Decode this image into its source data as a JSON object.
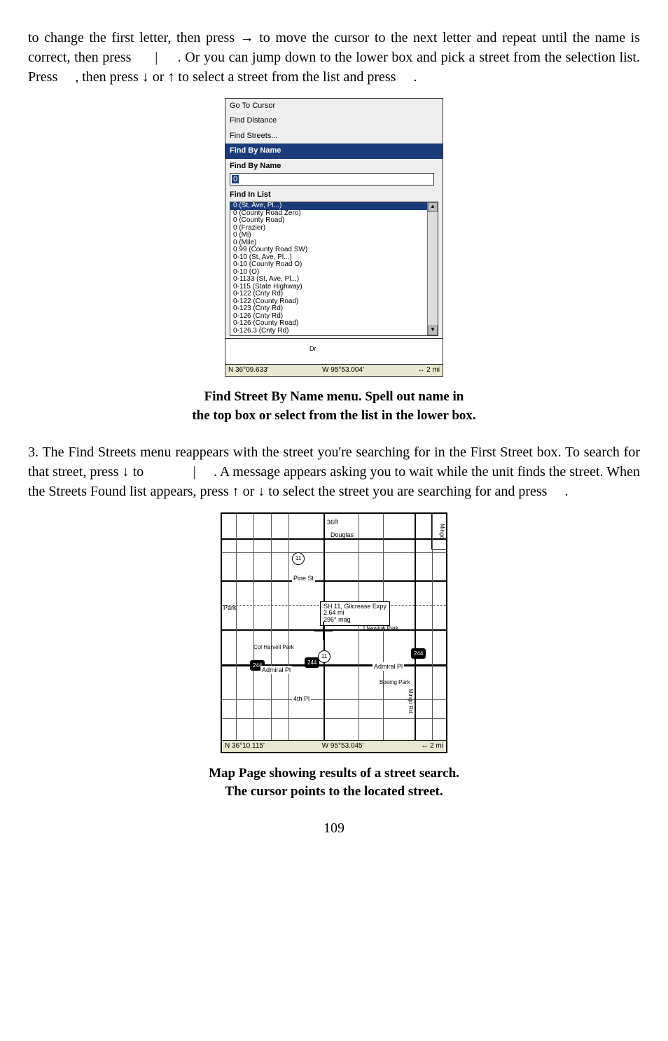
{
  "para1": "to change the first letter, then press → to move the cursor to the next letter and repeat until the name is correct, then press      |     . Or you can jump down to the lower box and pick a street from the selection list. Press     , then press ↓ or ↑ to select a street from the list and press     .",
  "caption1_line1": "Find Street By Name menu. Spell out name in",
  "caption1_line2": "the top box or select from the list in the lower box.",
  "para2": "3. The Find Streets menu reappears with the street you're searching for in the First Street box. To search for that street, press ↓ to              |     . A message appears asking you to wait while the unit finds the street. When the Streets Found list appears, press ↑ or ↓ to select the street you are searching for and press     .",
  "caption2_line1": "Map Page showing results of a street search.",
  "caption2_line2": "The cursor points to the located street.",
  "page_number": "109",
  "dialog": {
    "menu": {
      "item1": "Go To Cursor",
      "item2": "Find Distance",
      "item3": "Find Streets..."
    },
    "title": "Find By Name",
    "find_by_name_label": "Find By Name",
    "input_value": "0",
    "find_in_list_label": "Find In List",
    "list": [
      "0 (St, Ave, Pl...)",
      "0 (County Road Zero)",
      "0 (County Road)",
      "0 (Frazier)",
      "0 (Mi)",
      "0 (Mile)",
      "0 99 (County Road SW)",
      "0-10 (St, Ave, Pl...)",
      "0-10 (County Road O)",
      "0-10 (O)",
      "0-1133 (St, Ave, Pl...)",
      "0-115 (State Highway)",
      "0-122 (Cnty Rd)",
      "0-122 (County Road)",
      "0-123 (Cnty Rd)",
      "0-126 (Cnty Rd)",
      "0-126 (County Road)",
      "0-126.3 (Cnty Rd)"
    ],
    "status": {
      "lat": "N    36°09.633'",
      "lon": "W    95°53.004'",
      "dist_icon": "↔",
      "dist": "2 mi"
    },
    "scroll_up": "▲",
    "scroll_down": "▼"
  },
  "map": {
    "scale_text": "Mingo",
    "north": "36R",
    "douglas": "Douglas",
    "pine": "Pine St",
    "park1": "Park",
    "info": {
      "line1": "SH 11, Gilcrease Expy",
      "line2": "2.64 mi",
      "line3": "296° mag"
    },
    "newton": "J.Newton Park",
    "parkname": "Col Harvell Park",
    "admiral_l": "Admiral Pl",
    "admiral_r": "Admiral Pl",
    "boeing": "Boeing Park",
    "fourth": "4th Pl",
    "mingo_rd": "Mingo Rd",
    "hwy11": "11",
    "hwy244_a": "244",
    "hwy244_b": "244",
    "hwy244_c": "244",
    "status": {
      "lat": "N    36°10.115'",
      "lon": "W    95°53.045'",
      "dist_icon": "↔",
      "dist": "2 mi"
    }
  }
}
